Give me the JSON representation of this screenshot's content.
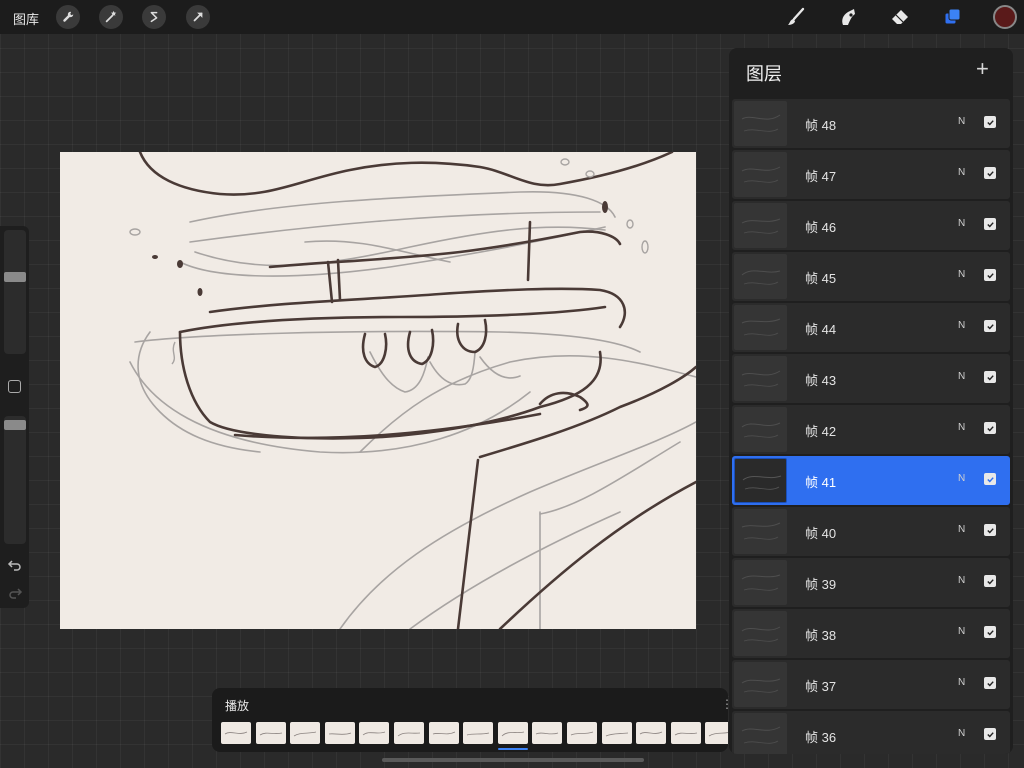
{
  "topbar": {
    "gallery_label": "图库",
    "left_tools": [
      {
        "icon": "wrench-icon",
        "name": "actions"
      },
      {
        "icon": "magic-wand-icon",
        "name": "adjustments"
      },
      {
        "icon": "selection-s-icon",
        "name": "selection"
      },
      {
        "icon": "transform-arrow-icon",
        "name": "transform"
      }
    ],
    "right_tools": [
      {
        "icon": "brush-icon",
        "name": "paint"
      },
      {
        "icon": "smudge-icon",
        "name": "smudge"
      },
      {
        "icon": "eraser-icon",
        "name": "erase"
      },
      {
        "icon": "layers-icon",
        "name": "layers",
        "active": true
      }
    ],
    "current_color": "#5a1a1a"
  },
  "sidebar": {
    "brush_size_level": 0.35,
    "opacity_level": 0.1
  },
  "layers_panel": {
    "title": "图层",
    "add_symbol": "+",
    "accent_color": "#2f6ff0",
    "layers": [
      {
        "name": "帧 48",
        "blend": "N",
        "visible": true,
        "selected": false
      },
      {
        "name": "帧 47",
        "blend": "N",
        "visible": true,
        "selected": false
      },
      {
        "name": "帧 46",
        "blend": "N",
        "visible": true,
        "selected": false
      },
      {
        "name": "帧 45",
        "blend": "N",
        "visible": true,
        "selected": false
      },
      {
        "name": "帧 44",
        "blend": "N",
        "visible": true,
        "selected": false
      },
      {
        "name": "帧 43",
        "blend": "N",
        "visible": true,
        "selected": false
      },
      {
        "name": "帧 42",
        "blend": "N",
        "visible": true,
        "selected": false
      },
      {
        "name": "帧 41",
        "blend": "N",
        "visible": true,
        "selected": true
      },
      {
        "name": "帧 40",
        "blend": "N",
        "visible": true,
        "selected": false
      },
      {
        "name": "帧 39",
        "blend": "N",
        "visible": true,
        "selected": false
      },
      {
        "name": "帧 38",
        "blend": "N",
        "visible": true,
        "selected": false
      },
      {
        "name": "帧 37",
        "blend": "N",
        "visible": true,
        "selected": false
      },
      {
        "name": "帧 36",
        "blend": "N",
        "visible": true,
        "selected": false
      }
    ]
  },
  "animation_bar": {
    "playback_label": "播放",
    "frame_count_visible": 15,
    "current_frame_index": 8
  }
}
